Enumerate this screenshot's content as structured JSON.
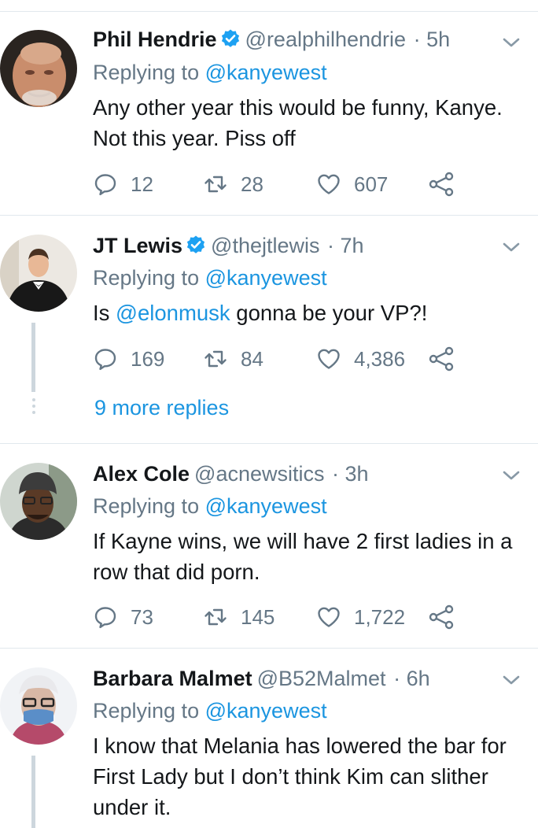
{
  "icons": {
    "reply": "reply-icon",
    "retweet": "retweet-icon",
    "like": "heart-icon",
    "share": "share-icon",
    "verified": "verified-badge-icon",
    "menu": "chevron-down-icon"
  },
  "colors": {
    "link": "#1b95e0",
    "secondary": "#657786",
    "verified": "#1da1f2",
    "divider": "#e1e8ed"
  },
  "tweets": [
    {
      "name": "Phil Hendrie",
      "handle": "@realphilhendrie",
      "time": "· 5h",
      "verified": true,
      "replying_prefix": "Replying to",
      "replying_to": "@kanyewest",
      "text": "Any other year this would be funny, Kanye. Not this year. Piss off",
      "replies": "12",
      "retweets": "28",
      "likes": "607"
    },
    {
      "name": "JT Lewis",
      "handle": "@thejtlewis",
      "time": "· 7h",
      "verified": true,
      "replying_prefix": "Replying to",
      "replying_to": "@kanyewest",
      "text_before": "Is ",
      "text_mention": "@elonmusk",
      "text_after": " gonna be your VP?!",
      "replies": "169",
      "retweets": "84",
      "likes": "4,386",
      "more_replies": "9 more replies"
    },
    {
      "name": "Alex Cole",
      "handle": "@acnewsitics",
      "time": "· 3h",
      "verified": false,
      "replying_prefix": "Replying to",
      "replying_to": "@kanyewest",
      "text": "If Kayne wins, we will have 2 first ladies in a row that did porn.",
      "replies": "73",
      "retweets": "145",
      "likes": "1,722"
    },
    {
      "name": "Barbara Malmet",
      "handle": "@B52Malmet",
      "time": "· 6h",
      "verified": false,
      "replying_prefix": "Replying to",
      "replying_to": "@kanyewest",
      "text": "I know that Melania has lowered the bar for First Lady but I don’t think Kim can slither under it."
    }
  ]
}
